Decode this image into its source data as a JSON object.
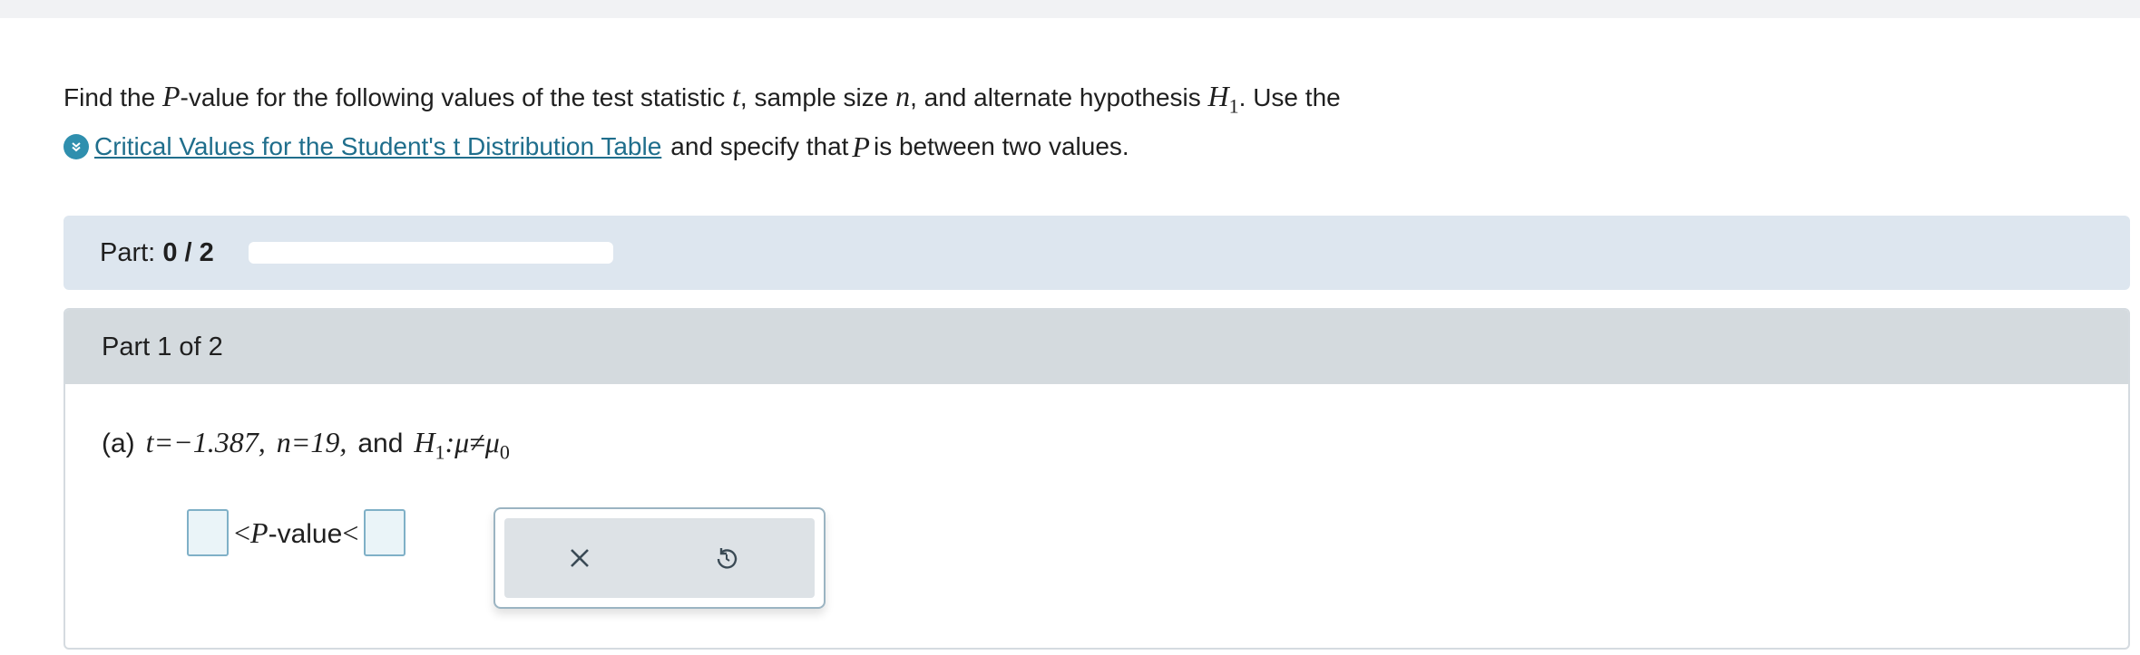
{
  "prompt": {
    "line1_pre": "Find the ",
    "var_p": "P",
    "line1_mid1": "-value for the following values of the test statistic ",
    "var_t": "t",
    "line1_mid2": ", sample size ",
    "var_n": "n",
    "line1_mid3": ", and alternate hypothesis ",
    "var_h": "H",
    "var_h_sub": "1",
    "line1_post": ". Use the",
    "link_text": "Critical Values for the Student's t Distribution Table",
    "line2_mid": "and specify that ",
    "var_p2": "P",
    "line2_post": " is between two values."
  },
  "progress": {
    "label": "Part: ",
    "value_text": "0 / 2",
    "fraction": 0
  },
  "part": {
    "header": "Part 1 of 2",
    "label": "(a)",
    "t_expr": "t=−1.387,",
    "n_expr": "n=19,",
    "and_text": "and",
    "h_var": "H",
    "h_sub": "1",
    "h_rel": ":μ≠μ",
    "mu_sub": "0"
  },
  "answer": {
    "lt1": "<",
    "p_var": "P",
    "value_text": "-value",
    "lt2": "<"
  },
  "tools": {
    "clear_icon": "x-icon",
    "undo_icon": "undo-icon"
  },
  "colors": {
    "accent": "#1f6e8c",
    "progress_bg": "#dde6ef",
    "header_bg": "#d4dade",
    "input_border": "#7fb0c7"
  }
}
